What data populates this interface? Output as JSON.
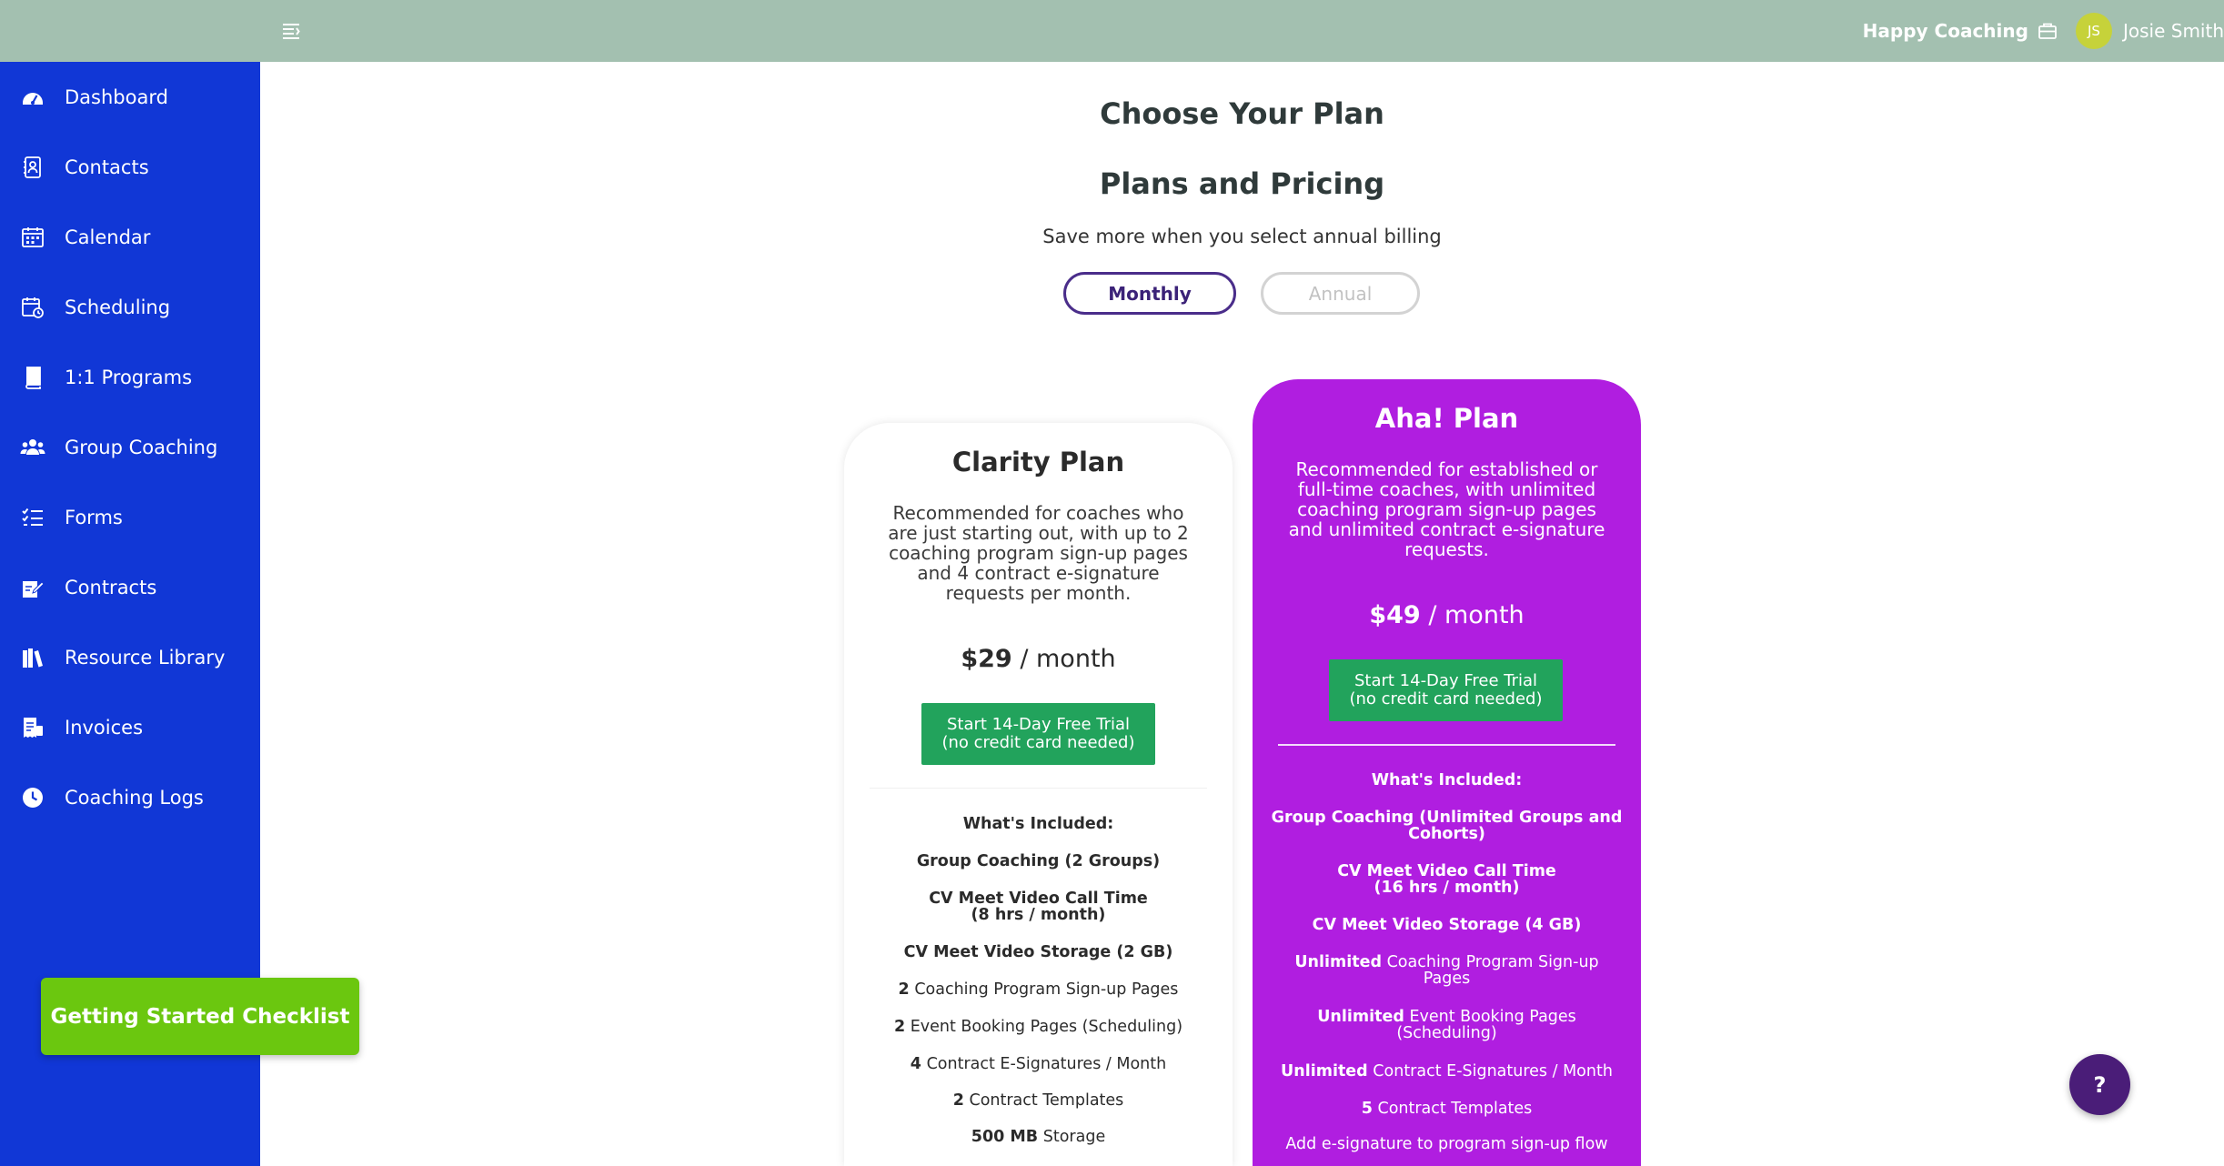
{
  "header": {
    "org_name": "Happy Coaching",
    "user_initials": "JS",
    "user_name": "Josie Smith"
  },
  "sidebar": {
    "items": [
      {
        "label": "Dashboard",
        "icon": "dashboard-icon"
      },
      {
        "label": "Contacts",
        "icon": "contacts-icon"
      },
      {
        "label": "Calendar",
        "icon": "calendar-icon"
      },
      {
        "label": "Scheduling",
        "icon": "scheduling-icon"
      },
      {
        "label": "1:1 Programs",
        "icon": "book-icon"
      },
      {
        "label": "Group Coaching",
        "icon": "group-icon"
      },
      {
        "label": "Forms",
        "icon": "forms-icon"
      },
      {
        "label": "Contracts",
        "icon": "contracts-icon"
      },
      {
        "label": "Resource Library",
        "icon": "library-icon"
      },
      {
        "label": "Invoices",
        "icon": "invoices-icon"
      },
      {
        "label": "Coaching Logs",
        "icon": "clock-icon"
      }
    ],
    "checklist_label": "Getting Started Checklist"
  },
  "main": {
    "title": "Choose Your Plan",
    "subtitle": "Plans and Pricing",
    "billing_note": "Save more when you select annual billing",
    "toggle_monthly": "Monthly",
    "toggle_annual": "Annual"
  },
  "plans": {
    "clarity": {
      "name": "Clarity Plan",
      "description": "Recommended for coaches who are just starting out, with up to 2 coaching program sign-up pages and 4 contract e-signature requests per month.",
      "price": "$29",
      "period": "/ month",
      "trial_line1": "Start 14-Day Free Trial",
      "trial_line2": "(no credit card needed)",
      "included_heading": "What's Included:",
      "f_group": "Group Coaching (2 Groups)",
      "f_video_1": "CV Meet Video Call Time",
      "f_video_2": "(8 hrs / month)",
      "f_storage": "CV Meet Video Storage (2 GB)",
      "f_pages_num": "2",
      "f_pages_text": "Coaching Program Sign-up Pages",
      "f_event_num": "2",
      "f_event_text": "Event Booking Pages (Scheduling)",
      "f_esig_num": "4",
      "f_esig_text": "Contract E-Signatures / Month",
      "f_templates_num": "2",
      "f_templates_text": "Contract Templates",
      "f_store_num": "500 MB",
      "f_store_text": "Storage"
    },
    "aha": {
      "name": "Aha! Plan",
      "description": "Recommended for established or full-time coaches, with unlimited coaching program sign-up pages and unlimited contract e-signature requests.",
      "price": "$49",
      "period": "/ month",
      "trial_line1": "Start 14-Day Free Trial",
      "trial_line2": "(no credit card needed)",
      "included_heading": "What's Included:",
      "f_group": "Group Coaching (Unlimited Groups and Cohorts)",
      "f_video_1": "CV Meet Video Call Time",
      "f_video_2": "(16 hrs / month)",
      "f_storage": "CV Meet Video Storage (4 GB)",
      "f_pages_num": "Unlimited",
      "f_pages_text": "Coaching Program Sign-up Pages",
      "f_event_num": "Unlimited",
      "f_event_text": "Event Booking Pages (Scheduling)",
      "f_esig_num": "Unlimited",
      "f_esig_text": "Contract E-Signatures / Month",
      "f_templates_num": "5",
      "f_templates_text": "Contract Templates",
      "f_addon": "Add e-signature to program sign-up flow"
    }
  },
  "help_label": "?",
  "colors": {
    "topbar": "#a3c0b0",
    "sidebar": "#1137d6",
    "checklist": "#6bc70f",
    "aha_card": "#b01ee0",
    "trial_button": "#22a35c",
    "help_button": "#4a1d78",
    "toggle_active": "#4a2d8a"
  }
}
